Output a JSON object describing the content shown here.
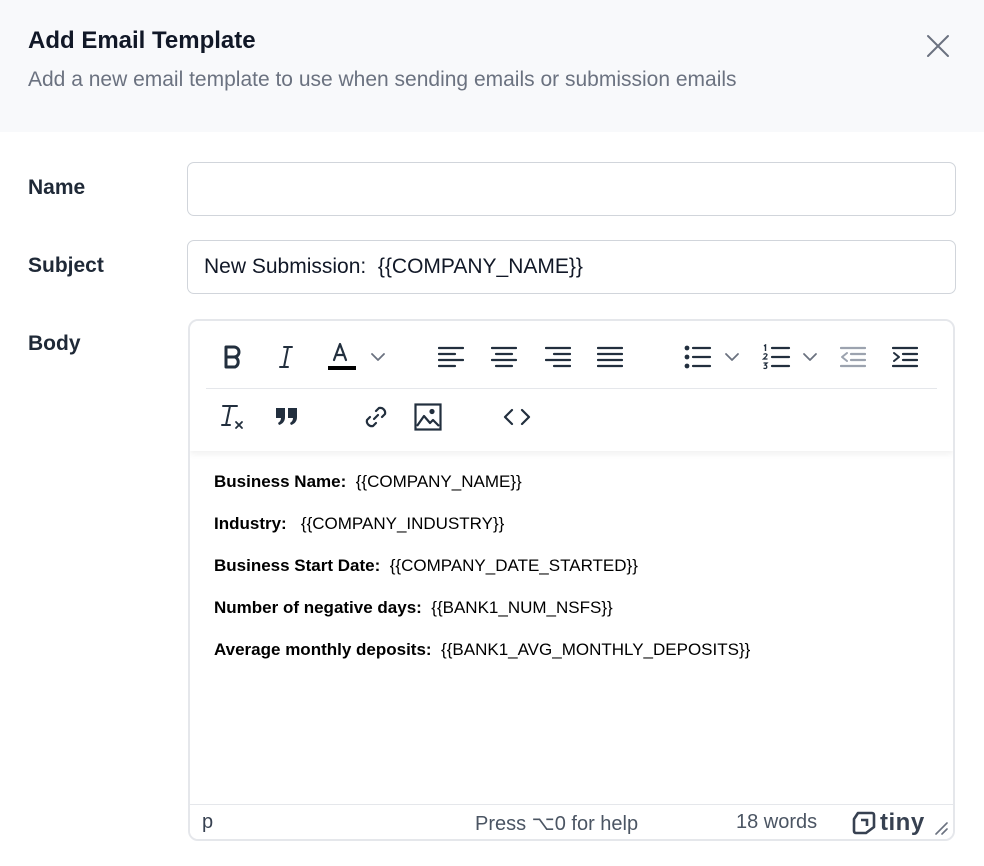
{
  "modal": {
    "title": "Add Email Template",
    "subtitle": "Add a new email template to use when sending emails or submission emails"
  },
  "form": {
    "name_label": "Name",
    "name_value": "",
    "name_placeholder": "",
    "subject_label": "Subject",
    "subject_value": "New Submission:  {{COMPANY_NAME}}",
    "body_label": "Body"
  },
  "editor": {
    "toolbar_icons": [
      "bold-icon",
      "italic-icon",
      "text-color-icon",
      "align-left-icon",
      "align-center-icon",
      "align-right-icon",
      "align-justify-icon",
      "bullet-list-icon",
      "numbered-list-icon",
      "outdent-icon",
      "indent-icon",
      "clear-formatting-icon",
      "blockquote-icon",
      "link-icon",
      "image-icon",
      "source-code-icon"
    ],
    "text_color": "#000000",
    "lines": [
      {
        "label": "Business Name:",
        "value": "  {{COMPANY_NAME}}"
      },
      {
        "label": "Industry:",
        "value": "   {{COMPANY_INDUSTRY}}"
      },
      {
        "label": "Business Start Date:",
        "value": "  {{COMPANY_DATE_STARTED}}"
      },
      {
        "label": "Number of negative days:",
        "value": "  {{BANK1_NUM_NSFS}}"
      },
      {
        "label": "Average monthly deposits:",
        "value": "  {{BANK1_AVG_MONTHLY_DEPOSITS}}"
      }
    ],
    "status": {
      "path": "p",
      "help": "Press ⌥0 for help",
      "word_count": "18 words",
      "brand": "tiny"
    }
  },
  "colors": {
    "header_bg": "#f8f9fb",
    "border": "#d1d5db",
    "icon": "#222f3e"
  }
}
